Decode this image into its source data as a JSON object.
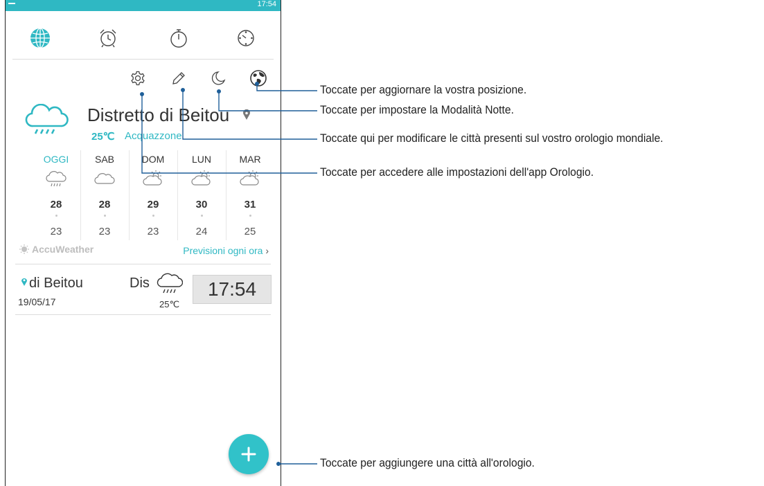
{
  "status_bar": {
    "time": "17:54"
  },
  "tabs": [
    {
      "name": "world-clock",
      "icon": "globe-icon",
      "active": true
    },
    {
      "name": "alarm",
      "icon": "alarm-clock-icon"
    },
    {
      "name": "stopwatch",
      "icon": "stopwatch-icon"
    },
    {
      "name": "timer",
      "icon": "timer-icon"
    }
  ],
  "toolbar": {
    "icons": [
      "gear-icon",
      "pencil-icon",
      "moon-icon",
      "globe-location-icon"
    ]
  },
  "weather": {
    "city": "Distretto di Beitou",
    "temperature": "25℃",
    "condition": "Acquazzone",
    "forecast": [
      {
        "day": "OGGI",
        "icon": "rain-cloud-icon",
        "high": "28",
        "low": "23"
      },
      {
        "day": "SAB",
        "icon": "cloud-icon",
        "high": "28",
        "low": "23"
      },
      {
        "day": "DOM",
        "icon": "sun-cloud-icon",
        "high": "29",
        "low": "23"
      },
      {
        "day": "LUN",
        "icon": "sun-cloud-icon",
        "high": "30",
        "low": "24"
      },
      {
        "day": "MAR",
        "icon": "sun-cloud-icon",
        "high": "31",
        "low": "25"
      }
    ],
    "provider": "AccuWeather",
    "hourly_link": "Previsioni ogni ora"
  },
  "clock_row": {
    "city": "di Beitou",
    "city_truncated": "Dis",
    "date": "19/05/17",
    "temperature": "25℃",
    "time": "17:54"
  },
  "callouts": {
    "location": "Toccate per aggiornare la vostra posizione.",
    "night_mode": "Toccate per impostare la Modalità Notte.",
    "edit_cities": "Toccate qui per modificare le città presenti sul vostro orologio mondiale.",
    "settings": "Toccate per accedere alle impostazioni dell'app Orologio.",
    "add_city": "Toccate per aggiungere una città all'orologio."
  },
  "colors": {
    "accent": "#2fb8c3",
    "fab": "#31c2c9",
    "callout_line": "#1f5f99"
  }
}
